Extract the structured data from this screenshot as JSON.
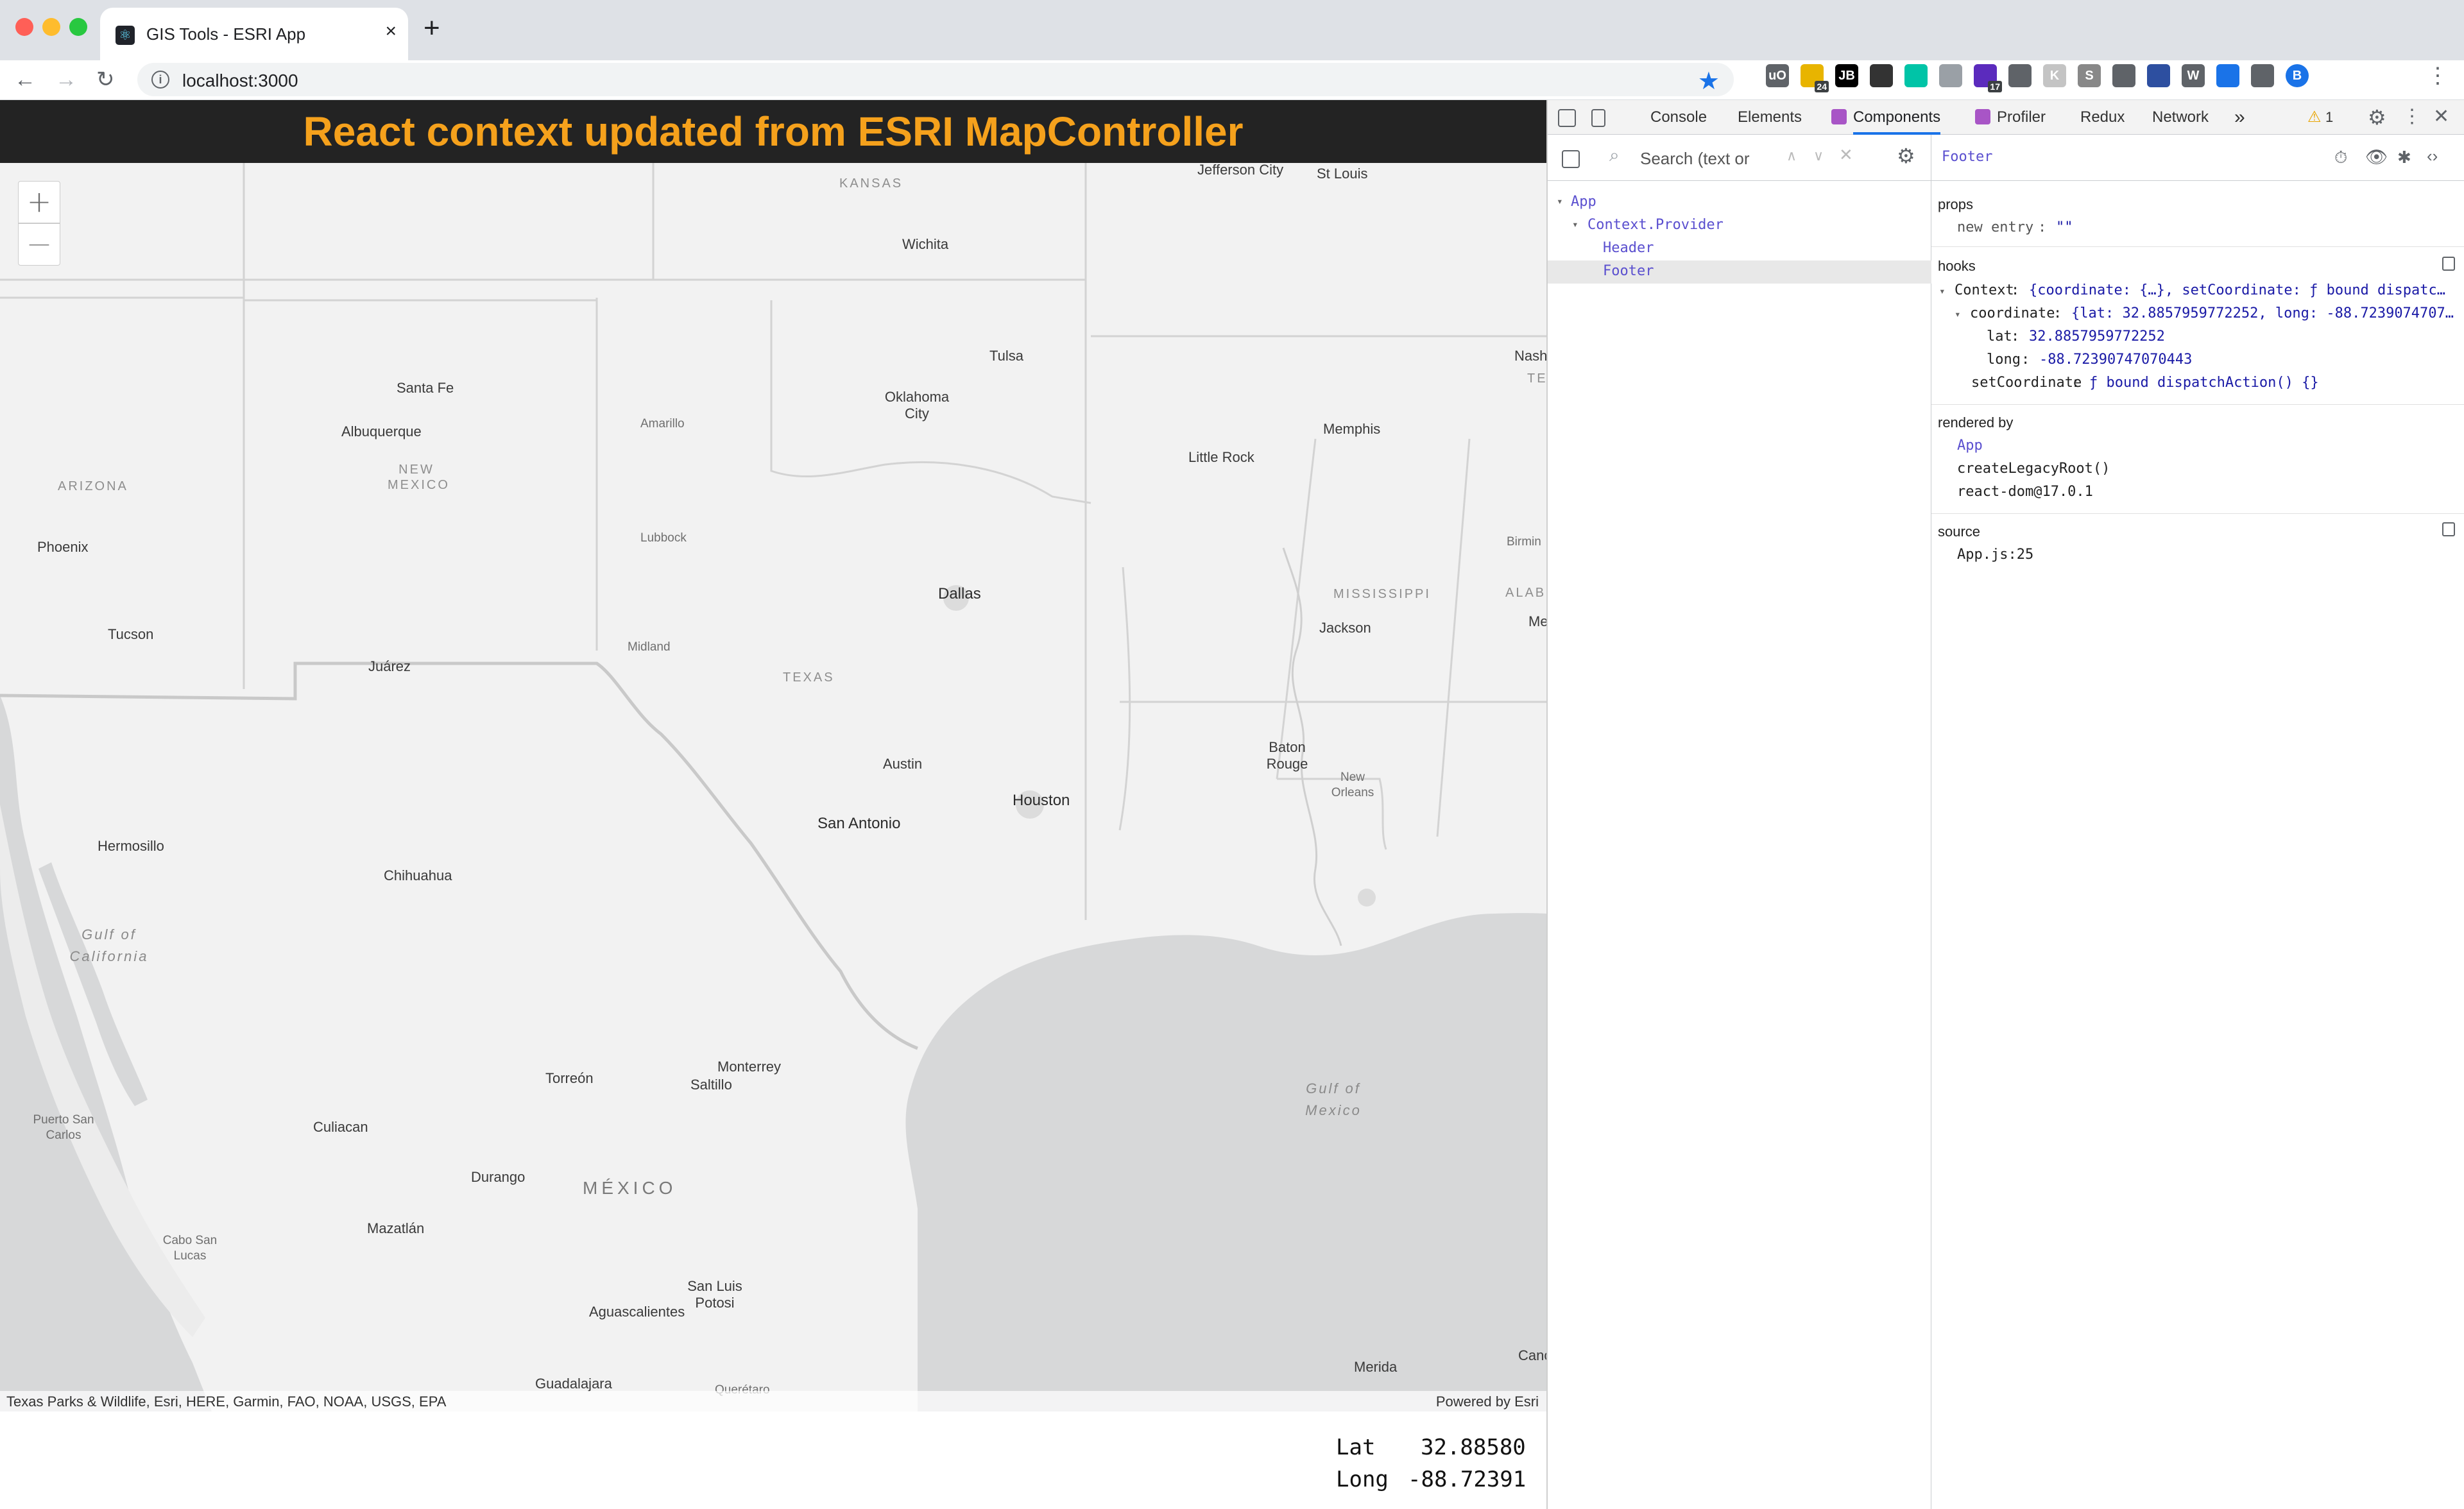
{
  "browser": {
    "tab_title": "GIS Tools - ESRI App",
    "url": "localhost:3000",
    "new_tab": "+",
    "tab_close": "×"
  },
  "extensions": [
    {
      "name": "ublock-icon",
      "label": "uO",
      "color": "#5f6368"
    },
    {
      "name": "badge-ext-icon",
      "label": "",
      "badge": "24",
      "color": "#e8b400"
    },
    {
      "name": "jetbrains-icon",
      "label": "JB",
      "color": "#000000"
    },
    {
      "name": "cube-icon",
      "label": "",
      "color": "#333333"
    },
    {
      "name": "diamond-icon",
      "label": "",
      "color": "#00c4a7"
    },
    {
      "name": "doc-icon",
      "label": "",
      "color": "#9aa0a6"
    },
    {
      "name": "hat-icon",
      "label": "",
      "badge": "17",
      "color": "#5b2bbd"
    },
    {
      "name": "moon-icon",
      "label": "",
      "color": "#5f6368"
    },
    {
      "name": "k-icon",
      "label": "K",
      "color": "#c4c4c4"
    },
    {
      "name": "s-icon",
      "label": "S",
      "color": "#888888"
    },
    {
      "name": "shield-icon",
      "label": "",
      "color": "#5f6368"
    },
    {
      "name": "react-shield-icon",
      "label": "",
      "color": "#2d4fa0"
    },
    {
      "name": "w-icon",
      "label": "W",
      "color": "#5f6368"
    },
    {
      "name": "triangle-icon",
      "label": "",
      "color": "#1a73e8"
    },
    {
      "name": "puzzle-icon",
      "label": "",
      "color": "#5f6368"
    },
    {
      "name": "profile-icon",
      "label": "B",
      "color": "#1a73e8"
    }
  ],
  "header": {
    "title": "React context updated from ESRI MapController"
  },
  "map": {
    "zoom_in": "+",
    "zoom_out": "—",
    "attribution": "Texas Parks & Wildlife, Esri, HERE, Garmin, FAO, NOAA, USGS, EPA",
    "powered_by": "Powered by Esri",
    "cities": [
      "Jefferson City",
      "St Louis",
      "Wichita",
      "Tulsa",
      "Oklahoma City",
      "Santa Fe",
      "Albuquerque",
      "Amarillo",
      "Memphis",
      "Little Rock",
      "Nash",
      "Phoenix",
      "Lubbock",
      "Dallas",
      "Birmin",
      "Tucson",
      "Midland",
      "Juárez",
      "Jackson",
      "Me",
      "Austin",
      "Houston",
      "San Antonio",
      "Baton Rouge",
      "New Orleans",
      "Hermosillo",
      "Chihuahua",
      "Monterrey",
      "Saltillo",
      "Torreón",
      "Culiacan",
      "Puerto San Carlos",
      "Durango",
      "Mazatlán",
      "Cabo San Lucas",
      "San Luis Potosi",
      "Aguascalientes",
      "Guadalajara",
      "Querétaro",
      "Merida",
      "Canc"
    ],
    "regions": [
      "KANSAS",
      "ARIZONA",
      "NEW MEXICO",
      "TEXAS",
      "MISSISSIPPI",
      "ALAB",
      "TE",
      "MÉXICO"
    ],
    "water": [
      "Gulf of California",
      "Gulf of Mexico"
    ]
  },
  "footer": {
    "lat_label": "Lat",
    "lat_value": "32.88580",
    "long_label": "Long",
    "long_value": "-88.72391"
  },
  "devtools": {
    "tabs": [
      "Console",
      "Elements",
      "Components",
      "Profiler",
      "Redux",
      "Network"
    ],
    "active_tab": "Components",
    "more": "»",
    "warnings": "1",
    "search_placeholder": "Search (text or",
    "tree": {
      "app": "App",
      "provider": "Context.Provider",
      "header": "Header",
      "footer": "Footer"
    },
    "selected_component": "Footer",
    "props_title": "props",
    "props": {
      "key": "new entry",
      "value": "\"\""
    },
    "hooks_title": "hooks",
    "hooks": {
      "context_key": "Context",
      "context_value": "{coordinate: {…}, setCoordinate: ƒ bound dispatc…",
      "coordinate_key": "coordinate",
      "coordinate_value": "{lat: 32.8857959772252, long: -88.7239074707…",
      "lat_key": "lat",
      "lat_value": "32.8857959772252",
      "long_key": "long",
      "long_value": "-88.72390747070443",
      "set_key": "setCoordinate",
      "set_value": "ƒ bound dispatchAction() {}"
    },
    "rendered_by_title": "rendered by",
    "rendered_by": [
      "App",
      "createLegacyRoot()",
      "react-dom@17.0.1"
    ],
    "source_title": "source",
    "source": "App.js:25"
  }
}
